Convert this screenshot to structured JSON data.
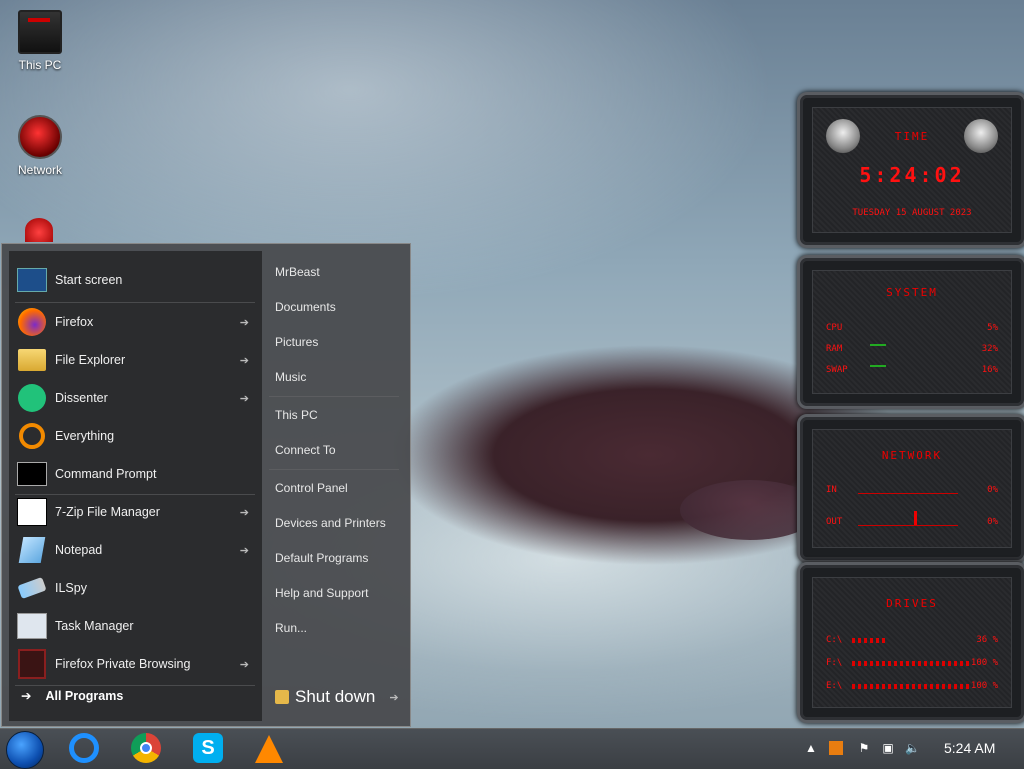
{
  "desktop": {
    "icons": [
      {
        "label": "This PC"
      },
      {
        "label": "Network"
      }
    ]
  },
  "start_menu": {
    "pinned": [
      {
        "label": "Start screen",
        "has_arrow": false
      },
      {
        "label": "Firefox",
        "has_arrow": true
      },
      {
        "label": "File Explorer",
        "has_arrow": true
      },
      {
        "label": "Dissenter",
        "has_arrow": true
      },
      {
        "label": "Everything",
        "has_arrow": false
      },
      {
        "label": "Command Prompt",
        "has_arrow": false
      },
      {
        "label": "7-Zip File Manager",
        "has_arrow": true
      },
      {
        "label": "Notepad",
        "has_arrow": true
      },
      {
        "label": "ILSpy",
        "has_arrow": false
      },
      {
        "label": "Task Manager",
        "has_arrow": false
      },
      {
        "label": "Firefox Private Browsing",
        "has_arrow": true
      }
    ],
    "all_programs": "All Programs",
    "arrow_glyph": "➔",
    "right_links": [
      "MrBeast",
      "Documents",
      "Pictures",
      "Music",
      "This PC",
      "Connect To",
      "Control Panel",
      "Devices and Printers",
      "Default Programs",
      "Help and Support",
      "Run..."
    ],
    "shutdown": "Shut down"
  },
  "gadgets": {
    "time": {
      "title": "TIME",
      "clock": "5:24:02",
      "date": "TUESDAY 15 AUGUST 2023"
    },
    "system": {
      "title": "SYSTEM",
      "rows": [
        {
          "label": "CPU",
          "value": "5%"
        },
        {
          "label": "RAM",
          "value": "32%"
        },
        {
          "label": "SWAP",
          "value": "16%"
        }
      ]
    },
    "network": {
      "title": "NETWORK",
      "rows": [
        {
          "label": "IN",
          "value": "0%"
        },
        {
          "label": "OUT",
          "value": "0%"
        }
      ]
    },
    "drives": {
      "title": "DRIVES",
      "rows": [
        {
          "label": "C:\\",
          "value": "36 %"
        },
        {
          "label": "F:\\",
          "value": "100 %"
        },
        {
          "label": "E:\\",
          "value": "100 %"
        }
      ]
    },
    "accent_color": "#ff1111"
  },
  "taskbar": {
    "apps": [
      "internet-explorer",
      "chrome",
      "skype",
      "vlc"
    ],
    "clock": "5:24 AM"
  }
}
